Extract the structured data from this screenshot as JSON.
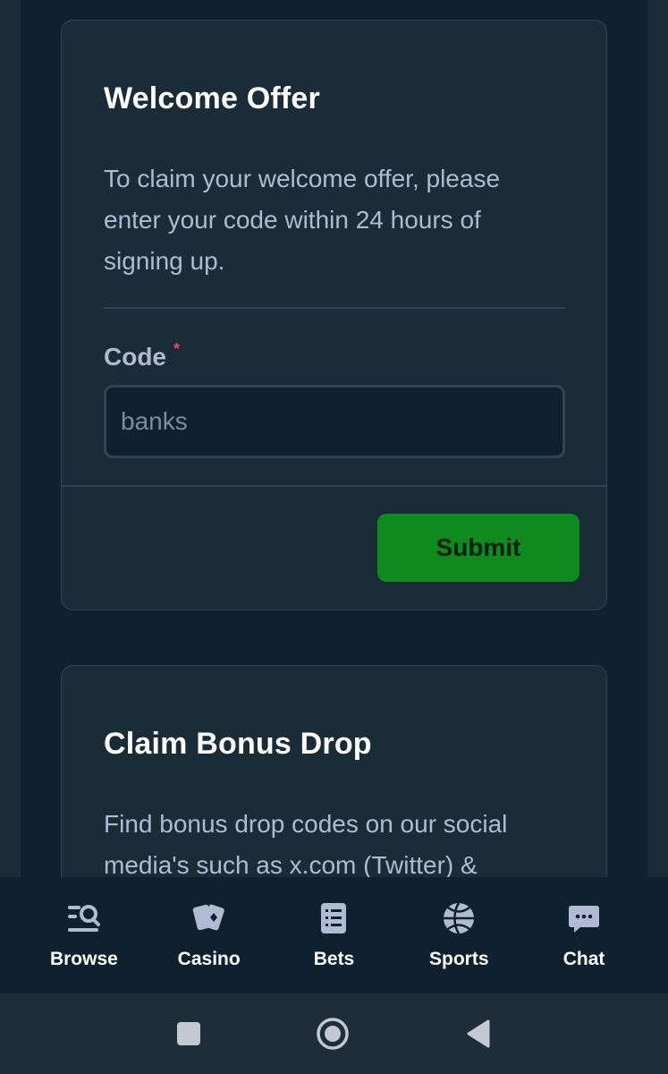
{
  "welcome": {
    "title": "Welcome Offer",
    "description": "To claim your welcome offer, please enter your code within 24 hours of signing up.",
    "code_label": "Code",
    "required_mark": "*",
    "code_placeholder": "banks",
    "submit_label": "Submit"
  },
  "bonus_drop": {
    "title": "Claim Bonus Drop",
    "description": "Find bonus drop codes on our social media's such as x.com (Twitter) &"
  },
  "bottom_nav": {
    "items": [
      {
        "label": "Browse",
        "icon": "browse-search-icon"
      },
      {
        "label": "Casino",
        "icon": "playing-cards-icon"
      },
      {
        "label": "Bets",
        "icon": "bet-slip-list-icon"
      },
      {
        "label": "Sports",
        "icon": "basketball-icon"
      },
      {
        "label": "Chat",
        "icon": "chat-bubble-icon"
      }
    ]
  },
  "system_nav": {
    "icons": [
      "recents-square-icon",
      "home-circle-icon",
      "back-triangle-icon"
    ]
  },
  "colors": {
    "background": "#0f212e",
    "card": "#1a2c38",
    "border": "#2f4553",
    "accent_green": "#0f8a1f",
    "required_red": "#ed4163",
    "muted_text": "#b1bad3"
  }
}
